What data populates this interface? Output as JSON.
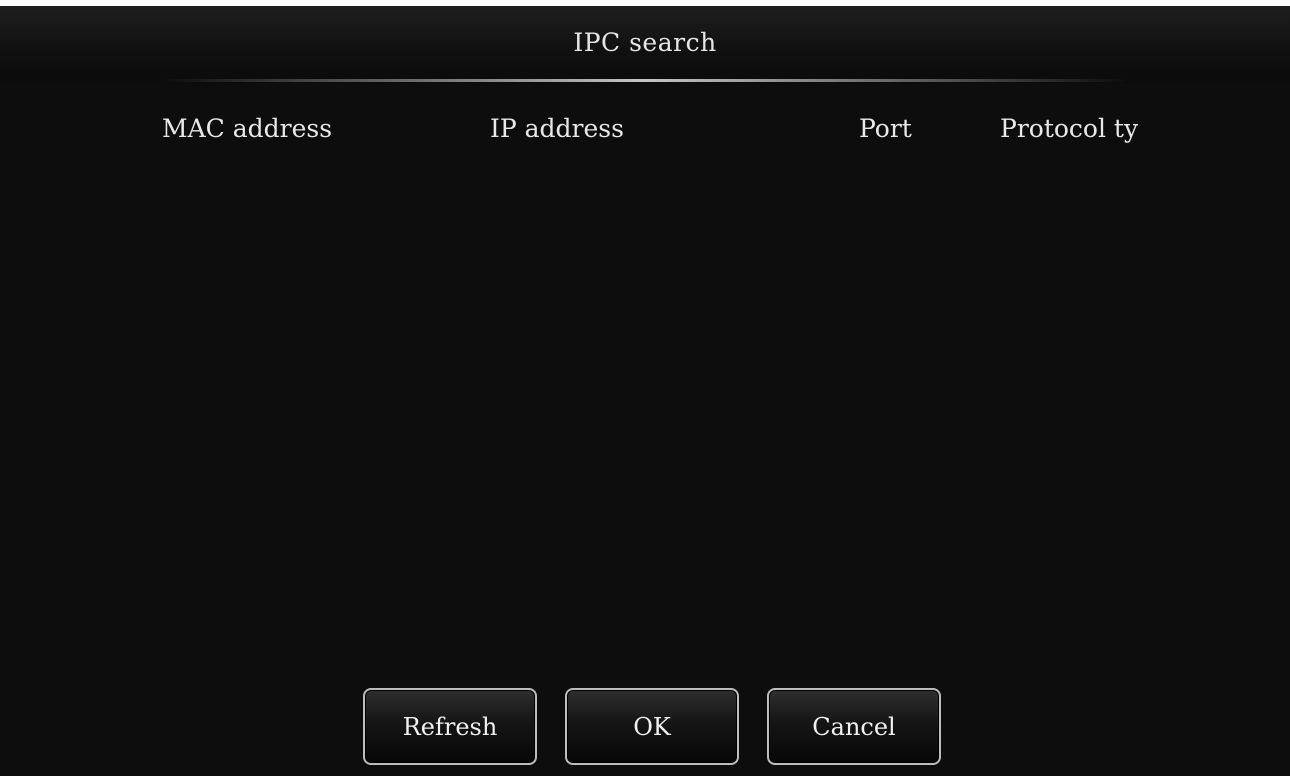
{
  "dialog": {
    "title": "IPC search"
  },
  "table": {
    "columns": [
      "MAC address",
      "IP address",
      "Port",
      "Protocol ty"
    ],
    "rows": []
  },
  "buttons": {
    "refresh": "Refresh",
    "ok": "OK",
    "cancel": "Cancel"
  },
  "colors": {
    "background": "#0d0d0d",
    "text": "#e8e8e8",
    "button_border": "#bdbdbd"
  }
}
